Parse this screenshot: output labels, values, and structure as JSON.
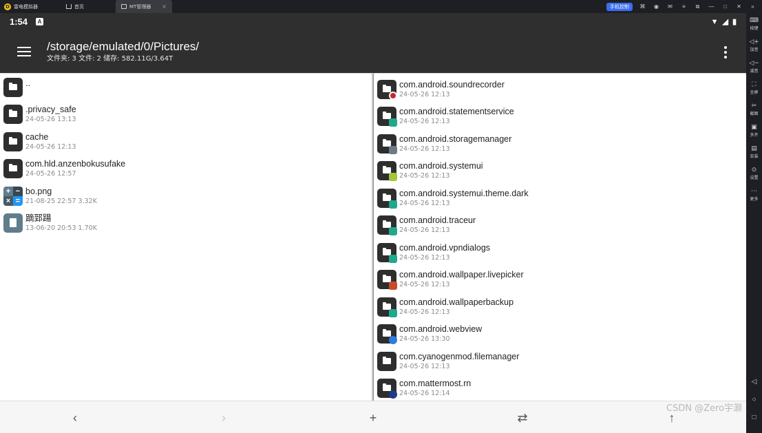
{
  "emulator": {
    "app_name": "雷电模拟器",
    "tabs": [
      {
        "label": "首页"
      },
      {
        "label": "MT管理器"
      }
    ],
    "phone_control_label": "手机控制",
    "sidebar": [
      {
        "label": "按键",
        "icon": "keyboard-icon"
      },
      {
        "label": "加音",
        "icon": "volume-up-icon"
      },
      {
        "label": "减音",
        "icon": "volume-down-icon"
      },
      {
        "label": "全屏",
        "icon": "fullscreen-icon"
      },
      {
        "label": "截图",
        "icon": "scissors-icon"
      },
      {
        "label": "多开",
        "icon": "multi-instance-icon"
      },
      {
        "label": "安装",
        "icon": "apk-install-icon"
      },
      {
        "label": "设置",
        "icon": "settings-icon"
      },
      {
        "label": "更多",
        "icon": "more-icon"
      }
    ]
  },
  "status_bar": {
    "time": "1:54"
  },
  "toolbar": {
    "path": "/storage/emulated/0/Pictures/",
    "summary": "文件夹: 3  文件: 2  储存: 582.11G/3.64T"
  },
  "left_pane": {
    "items": [
      {
        "name": "..",
        "meta": "",
        "type": "folder"
      },
      {
        "name": ".privacy_safe",
        "meta": "24-05-26 13:13",
        "type": "folder"
      },
      {
        "name": "cache",
        "meta": "24-05-26 12:13",
        "type": "folder"
      },
      {
        "name": "com.hld.anzenbokusufake",
        "meta": "24-05-26 12:57",
        "type": "folder"
      },
      {
        "name": "bo.png",
        "meta": "21-08-25 22:57  3.32K",
        "type": "image"
      },
      {
        "name": "蹢郅踼",
        "meta": "13-06-20 20:53  1.70K",
        "type": "file"
      }
    ]
  },
  "right_pane": {
    "items": [
      {
        "name": "com.android.soundrecorder",
        "meta": "24-05-26 12:13",
        "badge": "red"
      },
      {
        "name": "com.android.statementservice",
        "meta": "24-05-26 12:13",
        "badge": "teal"
      },
      {
        "name": "com.android.storagemanager",
        "meta": "24-05-26 12:13",
        "badge": "gray"
      },
      {
        "name": "com.android.systemui",
        "meta": "24-05-26 12:13",
        "badge": "lime"
      },
      {
        "name": "com.android.systemui.theme.dark",
        "meta": "24-05-26 12:13",
        "badge": "teal"
      },
      {
        "name": "com.android.traceur",
        "meta": "24-05-26 12:13",
        "badge": "teal"
      },
      {
        "name": "com.android.vpndialogs",
        "meta": "24-05-26 12:13",
        "badge": "teal"
      },
      {
        "name": "com.android.wallpaper.livepicker",
        "meta": "24-05-26 12:13",
        "badge": "orange"
      },
      {
        "name": "com.android.wallpaperbackup",
        "meta": "24-05-26 12:13",
        "badge": "teal"
      },
      {
        "name": "com.android.webview",
        "meta": "24-05-26 13:30",
        "badge": "globe"
      },
      {
        "name": "com.cyanogenmod.filemanager",
        "meta": "24-05-26 12:13",
        "badge": "none"
      },
      {
        "name": "com.mattermost.rn",
        "meta": "24-05-26 12:14",
        "badge": "navy"
      }
    ]
  },
  "bottom_bar": {
    "back_icon": "chevron-left-icon",
    "forward_icon": "chevron-right-icon",
    "add_icon": "plus-icon",
    "swap_icon": "swap-icon",
    "up_icon": "arrow-up-icon"
  },
  "watermark": "CSDN @Zero宇灏"
}
